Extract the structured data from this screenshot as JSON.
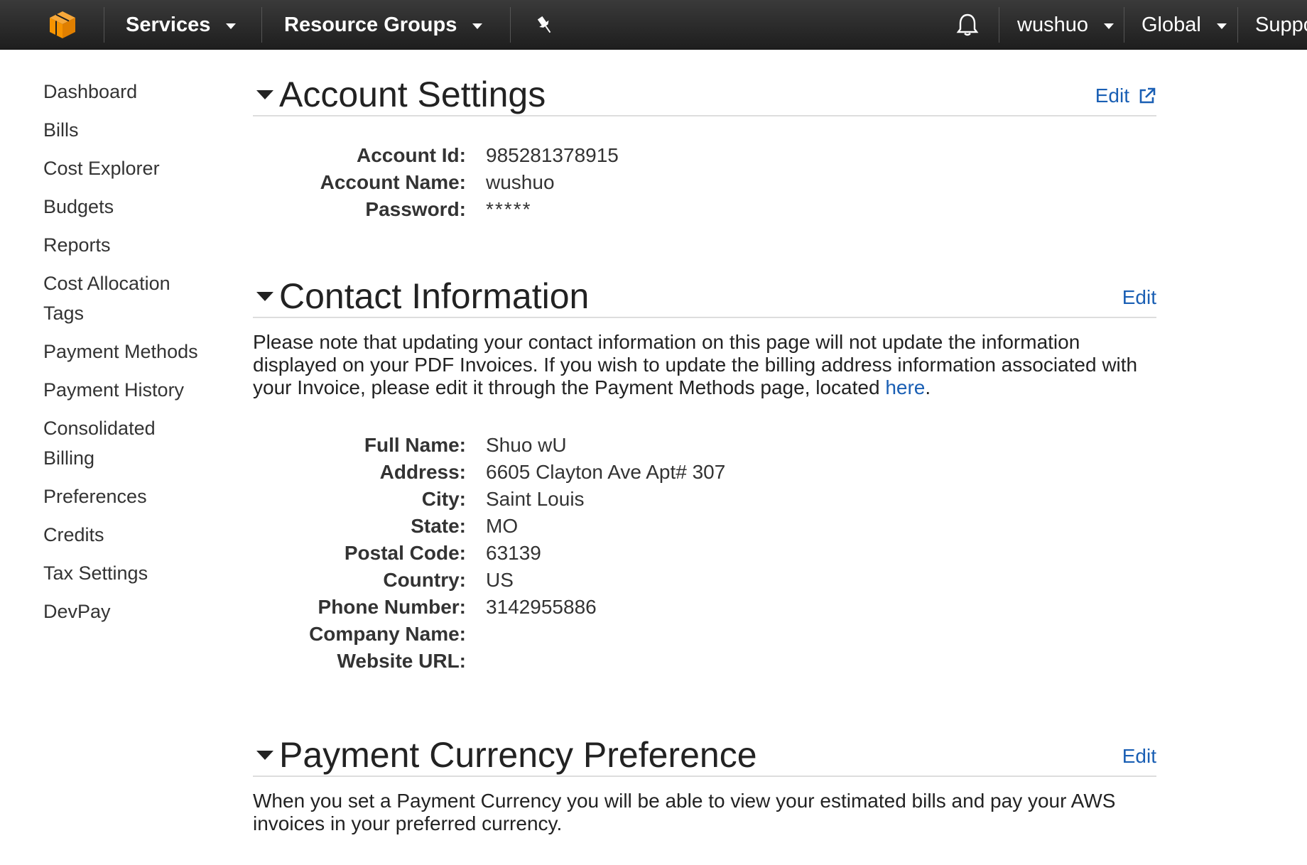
{
  "nav": {
    "logo_icon": "aws-cube-icon",
    "services_label": "Services",
    "resource_groups_label": "Resource Groups",
    "pin_icon": "pin-icon",
    "bell_icon": "bell-icon",
    "user_label": "wushuo",
    "region_label": "Global",
    "support_label": "Suppo",
    "accent_color": "#f79400"
  },
  "sidebar": {
    "items": [
      {
        "label": "Dashboard"
      },
      {
        "label": "Bills"
      },
      {
        "label": "Cost Explorer"
      },
      {
        "label": "Budgets"
      },
      {
        "label": "Reports"
      },
      {
        "label": "Cost Allocation Tags"
      },
      {
        "label": "Payment Methods"
      },
      {
        "label": "Payment History"
      },
      {
        "label": "Consolidated Billing"
      },
      {
        "label": "Preferences"
      },
      {
        "label": "Credits"
      },
      {
        "label": "Tax Settings"
      },
      {
        "label": "DevPay"
      }
    ]
  },
  "account_settings": {
    "title": "Account Settings",
    "edit_label": "Edit",
    "fields": [
      {
        "label": "Account Id:",
        "value": "985281378915"
      },
      {
        "label": "Account Name:",
        "value": "wushuo"
      },
      {
        "label": "Password:",
        "value": "*****"
      }
    ]
  },
  "contact_information": {
    "title": "Contact Information",
    "edit_label": "Edit",
    "note_before_link": "Please note that updating your contact information on this page will not update the information displayed on your PDF Invoices. If you wish to update the billing address information associated with your Invoice, please edit it through the Payment Methods page, located ",
    "note_link": "here",
    "note_after_link": ".",
    "fields": [
      {
        "label": "Full Name:",
        "value": "Shuo wU"
      },
      {
        "label": "Address:",
        "value": "6605 Clayton Ave Apt# 307"
      },
      {
        "label": "City:",
        "value": "Saint Louis"
      },
      {
        "label": "State:",
        "value": "MO"
      },
      {
        "label": "Postal Code:",
        "value": "63139"
      },
      {
        "label": "Country:",
        "value": "US"
      },
      {
        "label": "Phone Number:",
        "value": "3142955886"
      },
      {
        "label": "Company Name:",
        "value": ""
      },
      {
        "label": "Website URL:",
        "value": ""
      }
    ]
  },
  "payment_currency": {
    "title": "Payment Currency Preference",
    "edit_label": "Edit",
    "description": "When you set a Payment Currency you will be able to view your estimated bills and pay your AWS invoices in your preferred currency."
  }
}
